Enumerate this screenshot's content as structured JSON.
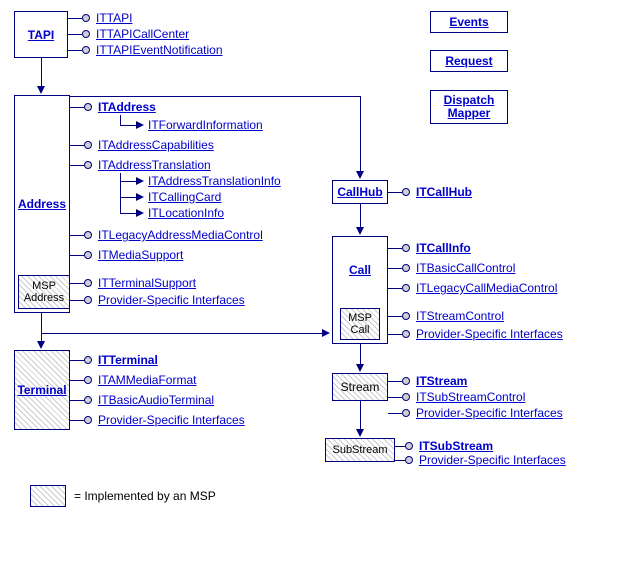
{
  "sideboxes": {
    "events": "Events",
    "request": "Request",
    "dispatch": "Dispatch\nMapper"
  },
  "tapi": {
    "label": "TAPI",
    "items": [
      "ITTAPI",
      "ITTAPICallCenter",
      "ITTAPIEventNotification"
    ]
  },
  "address": {
    "label": "Address",
    "itaddress": "ITAddress",
    "forward": "ITForwardInformation",
    "capabilities": "ITAddressCapabilities",
    "translation": "ITAddressTranslation",
    "trans_children": [
      "ITAddressTranslationInfo",
      "ITCallingCard",
      "ITLocationInfo"
    ],
    "legacy": "ITLegacyAddressMediaControl",
    "mediasupport": "ITMediaSupport",
    "terminalsupport": "ITTerminalSupport",
    "providerspecific": "Provider-Specific Interfaces",
    "msp_label": "MSP\nAddress"
  },
  "terminal": {
    "label": "Terminal",
    "items": [
      "ITTerminal",
      "ITAMMediaFormat",
      "ITBasicAudioTerminal",
      "Provider-Specific Interfaces"
    ]
  },
  "callhub": {
    "label": "CallHub",
    "item": "ITCallHub"
  },
  "call": {
    "label": "Call",
    "msp_label": "MSP\nCall",
    "items": [
      "ITCallInfo",
      "ITBasicCallControl",
      "ITLegacyCallMediaControl",
      "ITStreamControl",
      "Provider-Specific Interfaces"
    ]
  },
  "stream": {
    "label": "Stream",
    "items": [
      "ITStream",
      "ITSubStreamControl",
      "Provider-Specific Interfaces"
    ]
  },
  "substream": {
    "label": "SubStream",
    "items": [
      "ITSubStream",
      "Provider-Specific Interfaces"
    ]
  },
  "legend": "= Implemented by an MSP"
}
